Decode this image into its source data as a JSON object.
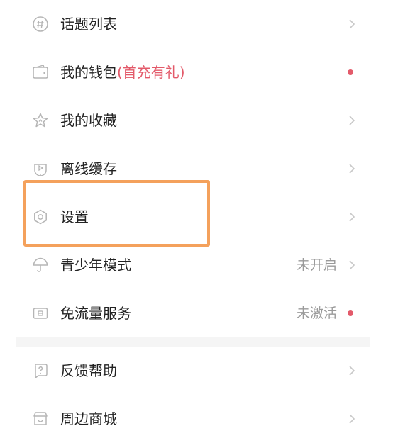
{
  "menu": {
    "topic_list": {
      "label": "话题列表",
      "icon": "hash-icon"
    },
    "wallet": {
      "label": "我的钱包",
      "promo": "(首充有礼)",
      "icon": "wallet-icon"
    },
    "favorites": {
      "label": "我的收藏",
      "icon": "star-icon"
    },
    "offline_cache": {
      "label": "离线缓存",
      "icon": "download-icon"
    },
    "settings": {
      "label": "设置",
      "icon": "gear-icon"
    },
    "teen_mode": {
      "label": "青少年模式",
      "status": "未开启",
      "icon": "umbrella-icon"
    },
    "free_data": {
      "label": "免流量服务",
      "status": "未激活",
      "icon": "sim-card-icon"
    },
    "feedback": {
      "label": "反馈帮助",
      "icon": "help-icon"
    },
    "shop": {
      "label": "周边商城",
      "icon": "store-icon"
    }
  },
  "colors": {
    "accent": "#e35a6a",
    "highlight_border": "#f4a15c",
    "icon_gray": "#b5b5b5",
    "text": "#222222",
    "muted_text": "#9a9a9a"
  }
}
